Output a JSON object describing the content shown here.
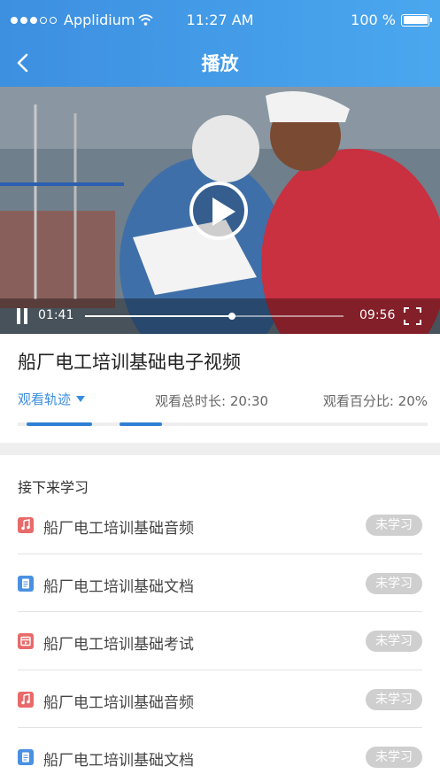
{
  "status_bar": {
    "carrier": "Applidium",
    "time": "11:27 AM",
    "battery": "100 %"
  },
  "nav": {
    "title": "播放"
  },
  "player": {
    "current_time": "01:41",
    "duration": "09:56",
    "progress_fraction": 0.57
  },
  "video_title": "船厂电工培训基础电子视频",
  "stats": {
    "track_label": "观看轨迹",
    "total_label": "观看总时长: 20:30",
    "percent_label": "观看百分比: 20%"
  },
  "up_next": {
    "title": "接下来学习",
    "items": [
      {
        "label": "船厂电工培训基础音频",
        "badge": "未学习",
        "icon": "music-icon",
        "color": "#e86a6a"
      },
      {
        "label": "船厂电工培训基础文档",
        "badge": "未学习",
        "icon": "document-icon",
        "color": "#4a90e2"
      },
      {
        "label": "船厂电工培训基础考试",
        "badge": "未学习",
        "icon": "exam-icon",
        "color": "#e86a6a"
      },
      {
        "label": "船厂电工培训基础音频",
        "badge": "未学习",
        "icon": "music-icon",
        "color": "#e86a6a"
      },
      {
        "label": "船厂电工培训基础文档",
        "badge": "未学习",
        "icon": "document-icon",
        "color": "#4a90e2"
      }
    ]
  },
  "colors": {
    "accent": "#3a8de0",
    "header": "#4aa7ee",
    "badge": "#cfcfcf"
  }
}
